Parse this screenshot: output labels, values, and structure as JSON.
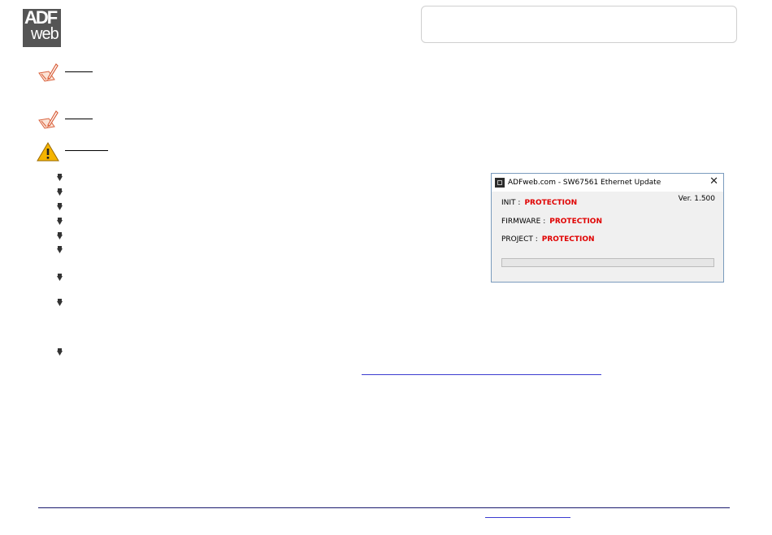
{
  "logo": {
    "line1": "ADF",
    "line2": "web"
  },
  "dialog": {
    "title": "ADFweb.com - SW67561 Ethernet Update",
    "close_glyph": "✕",
    "version": "Ver. 1.500",
    "rows": [
      {
        "label": "INIT :",
        "status": "PROTECTION"
      },
      {
        "label": "FIRMWARE :",
        "status": "PROTECTION"
      },
      {
        "label": "PROJECT :",
        "status": "PROTECTION"
      }
    ],
    "progress": 0
  },
  "icons": {
    "note": "pencil-note-icon",
    "warning": "warning-triangle-icon",
    "bullet": "arrow-bullet-icon"
  },
  "colors": {
    "status_red": "#e00000",
    "footer_rule": "#1a1a6e",
    "link": "#3b3bd0",
    "warning_fill": "#f5b400"
  }
}
